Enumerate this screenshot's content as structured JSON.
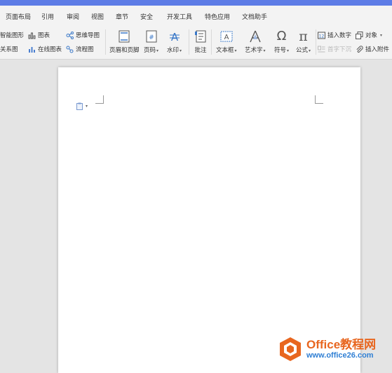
{
  "menu_tabs": [
    "页面布局",
    "引用",
    "审阅",
    "视图",
    "章节",
    "安全",
    "开发工具",
    "特色应用",
    "文档助手"
  ],
  "ribbon": {
    "smart_shape": "智能图形",
    "chart": "图表",
    "mind_map": "思维导图",
    "relation_chart": "关系图",
    "online_chart": "在线图表",
    "flowchart": "流程图",
    "header_footer": "页眉和页脚",
    "page_number": "页码",
    "watermark": "水印",
    "comment": "批注",
    "text_box": "文本框",
    "word_art": "艺术字",
    "symbol": "符号",
    "formula": "公式",
    "insert_number": "插入数字",
    "object": "对象",
    "drop_cap": "首字下沉",
    "insert_attachment": "插入附件"
  },
  "watermark_logo": {
    "title": "Office教程网",
    "url": "www.office26.com"
  },
  "colors": {
    "accent": "#5d7ce6",
    "ribbon_bg": "#f3f3f3",
    "canvas_bg": "#e4e4e4",
    "logo_orange": "#e8661f",
    "logo_blue": "#2f7fd4"
  }
}
